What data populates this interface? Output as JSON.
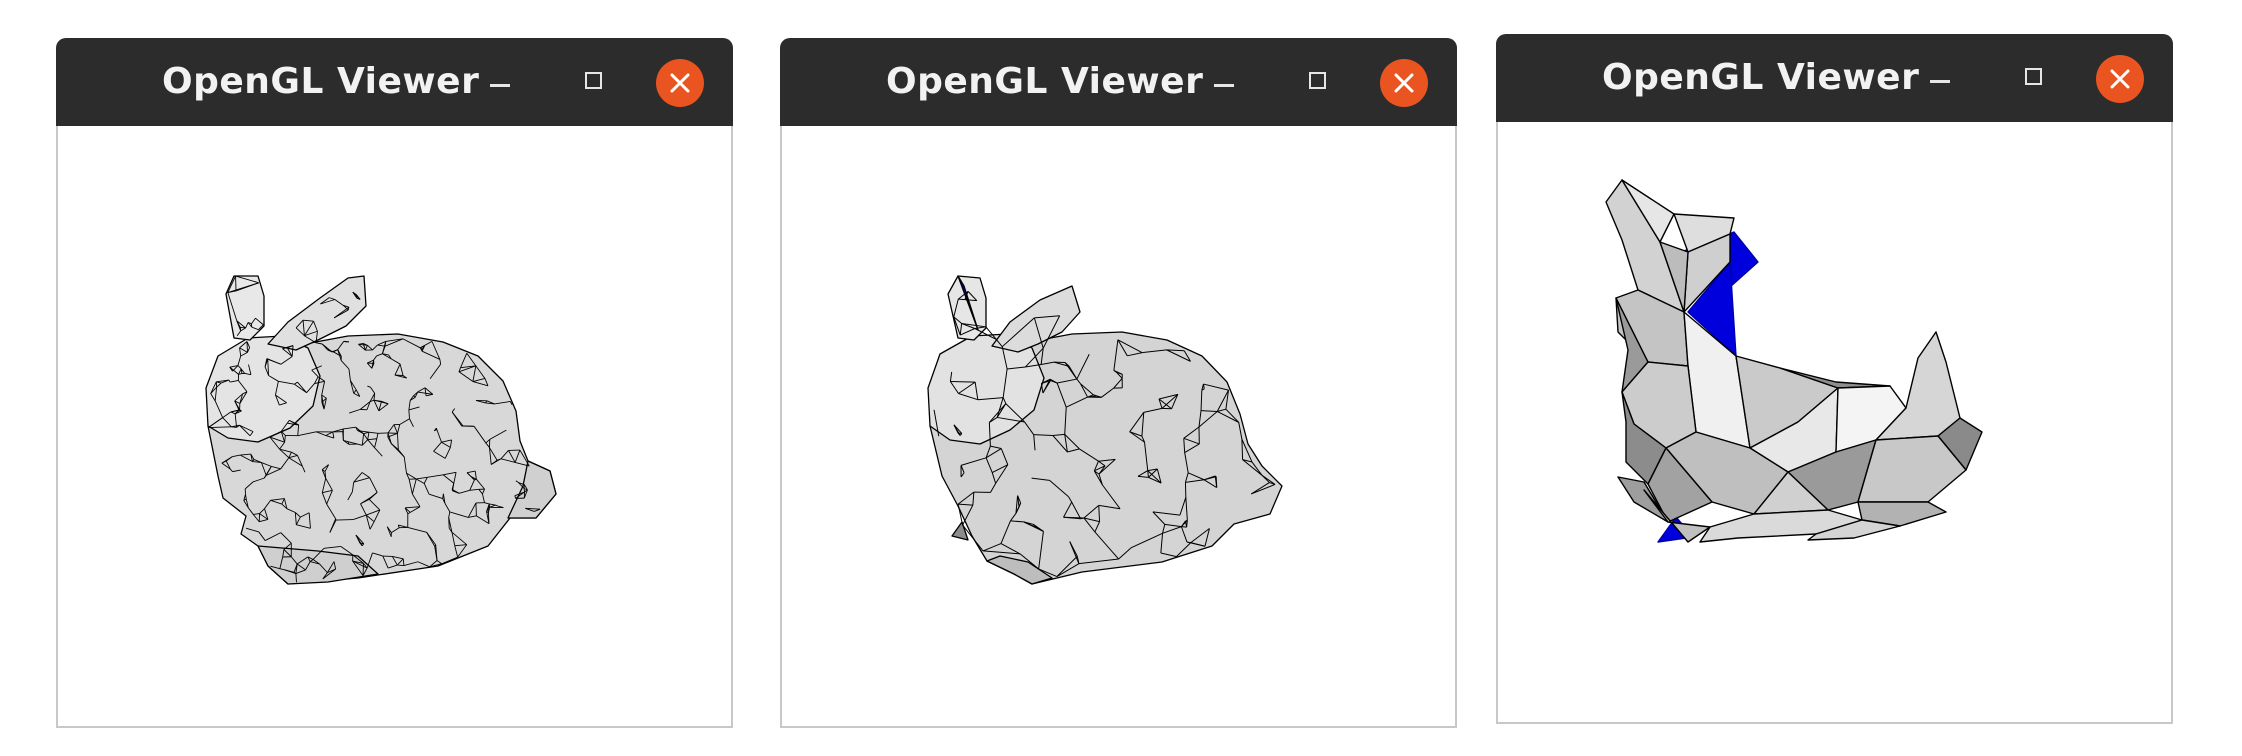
{
  "windows": [
    {
      "title": "OpenGL Viewer",
      "minimize_icon": "minimize-icon",
      "maximize_icon": "maximize-icon",
      "close_icon": "close-icon",
      "model": "bunny-high-detail-wireframe"
    },
    {
      "title": "OpenGL Viewer",
      "minimize_icon": "minimize-icon",
      "maximize_icon": "maximize-icon",
      "close_icon": "close-icon",
      "model": "bunny-medium-detail-wireframe"
    },
    {
      "title": "OpenGL Viewer",
      "minimize_icon": "minimize-icon",
      "maximize_icon": "maximize-icon",
      "close_icon": "close-icon",
      "model": "bunny-low-detail-wireframe"
    }
  ],
  "colors": {
    "titlebar": "#2c2c2c",
    "title_text": "#f2f2f2",
    "close_button": "#e95420",
    "mesh_fill_light": "#f0f0f0",
    "mesh_fill_mid": "#c8c8c8",
    "mesh_fill_dark": "#8c8c8c",
    "mesh_backface": "#0000dd",
    "mesh_edge": "#000000"
  }
}
